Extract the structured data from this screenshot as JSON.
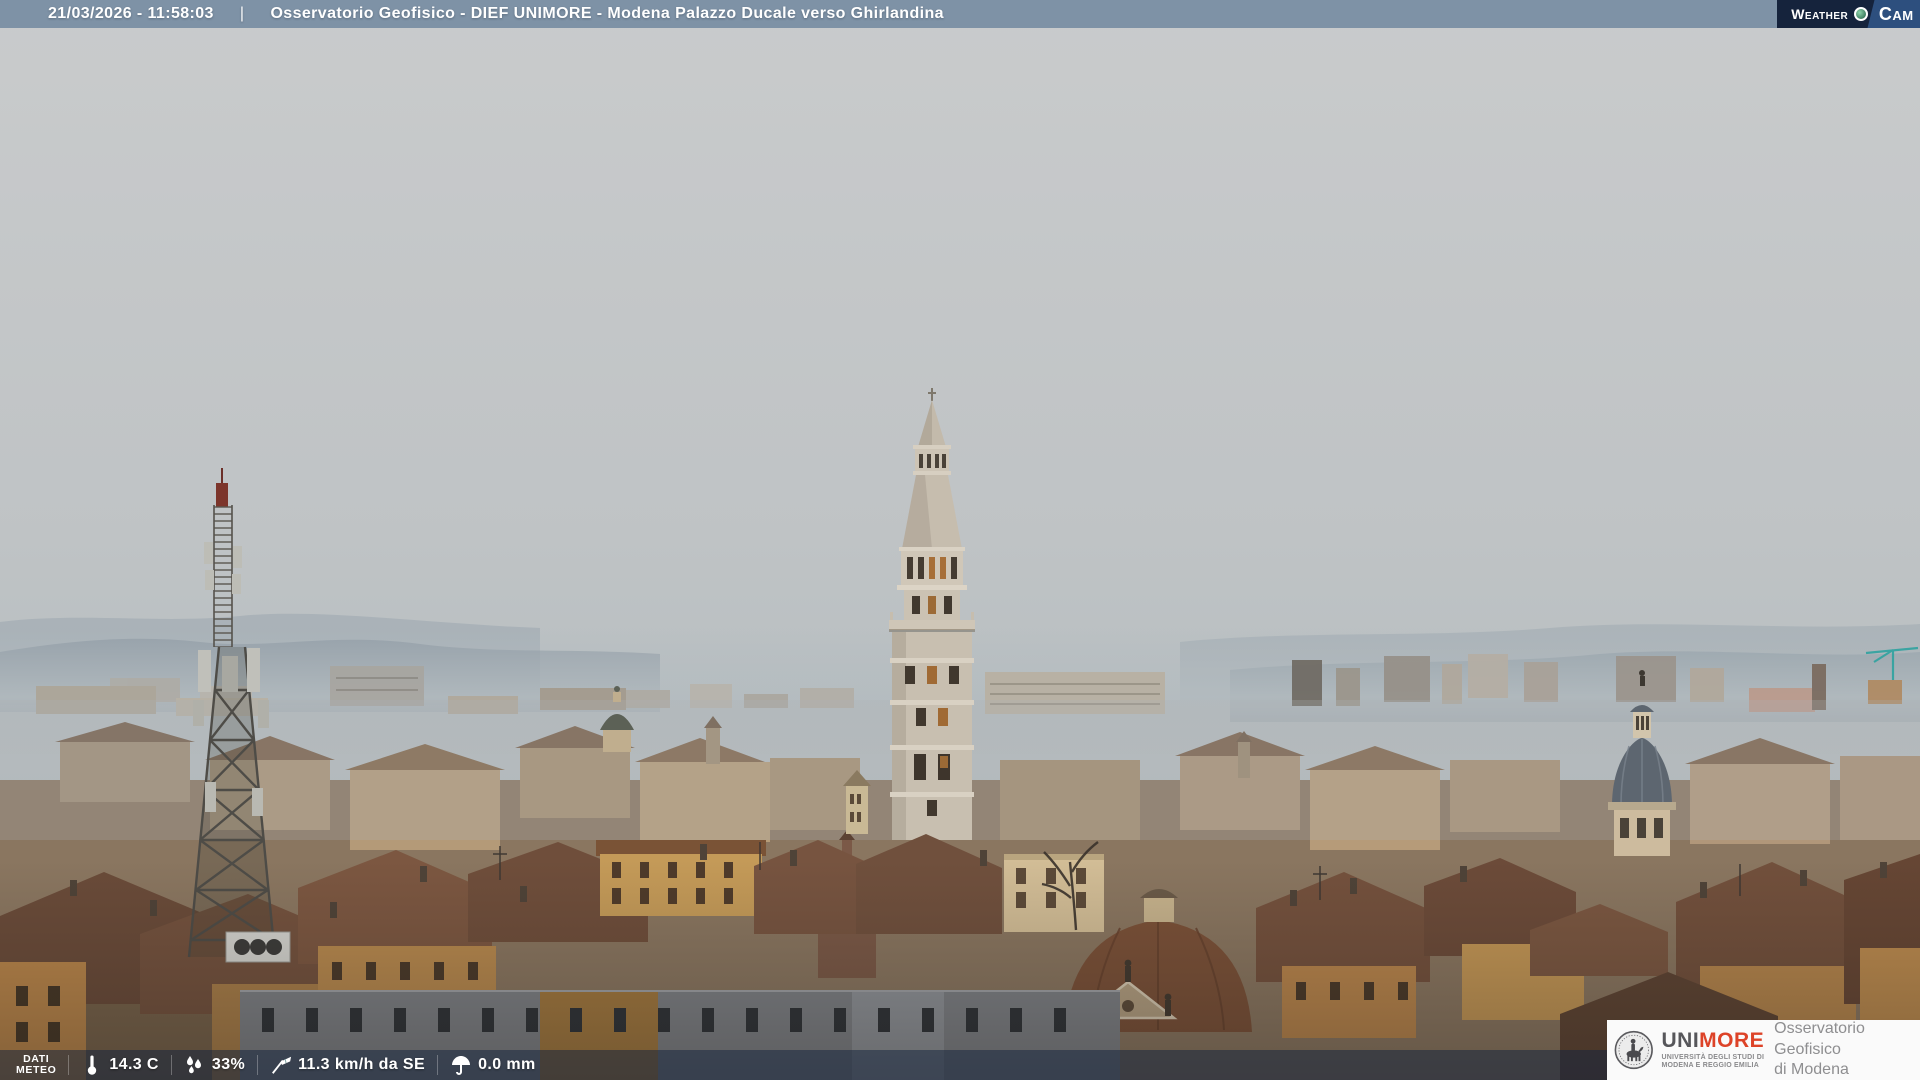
{
  "header": {
    "timestamp": "21/03/2026 - 11:58:03",
    "divider": "|",
    "title": "Osservatorio Geofisico - DIEF UNIMORE - Modena Palazzo Ducale verso Ghirlandina"
  },
  "watermark": {
    "word1": "Weather",
    "word2": "Cam"
  },
  "weather": {
    "label": [
      "DATI",
      "METEO"
    ],
    "temperature": "14.3 C",
    "humidity": "33%",
    "wind": "11.3 km/h da SE",
    "rain": "0.0 mm"
  },
  "credit": {
    "uni": "UNI",
    "more": "MORE",
    "line1": "UNIVERSITÀ DEGLI STUDI DI",
    "line2": "MODENA E REGGIO EMILIA",
    "org1": "Osservatorio Geofisico",
    "org2": "di Modena"
  },
  "colors": {
    "topbar": "#7e92a6",
    "bottom_overlay": "rgba(22,37,62,0.52)",
    "logo_navy": "#15233c",
    "logo_blue": "#2d4f7e",
    "brand_red": "#dd4328",
    "sky_top": "#c9cbcc",
    "sky_horizon": "#aab3b8"
  }
}
